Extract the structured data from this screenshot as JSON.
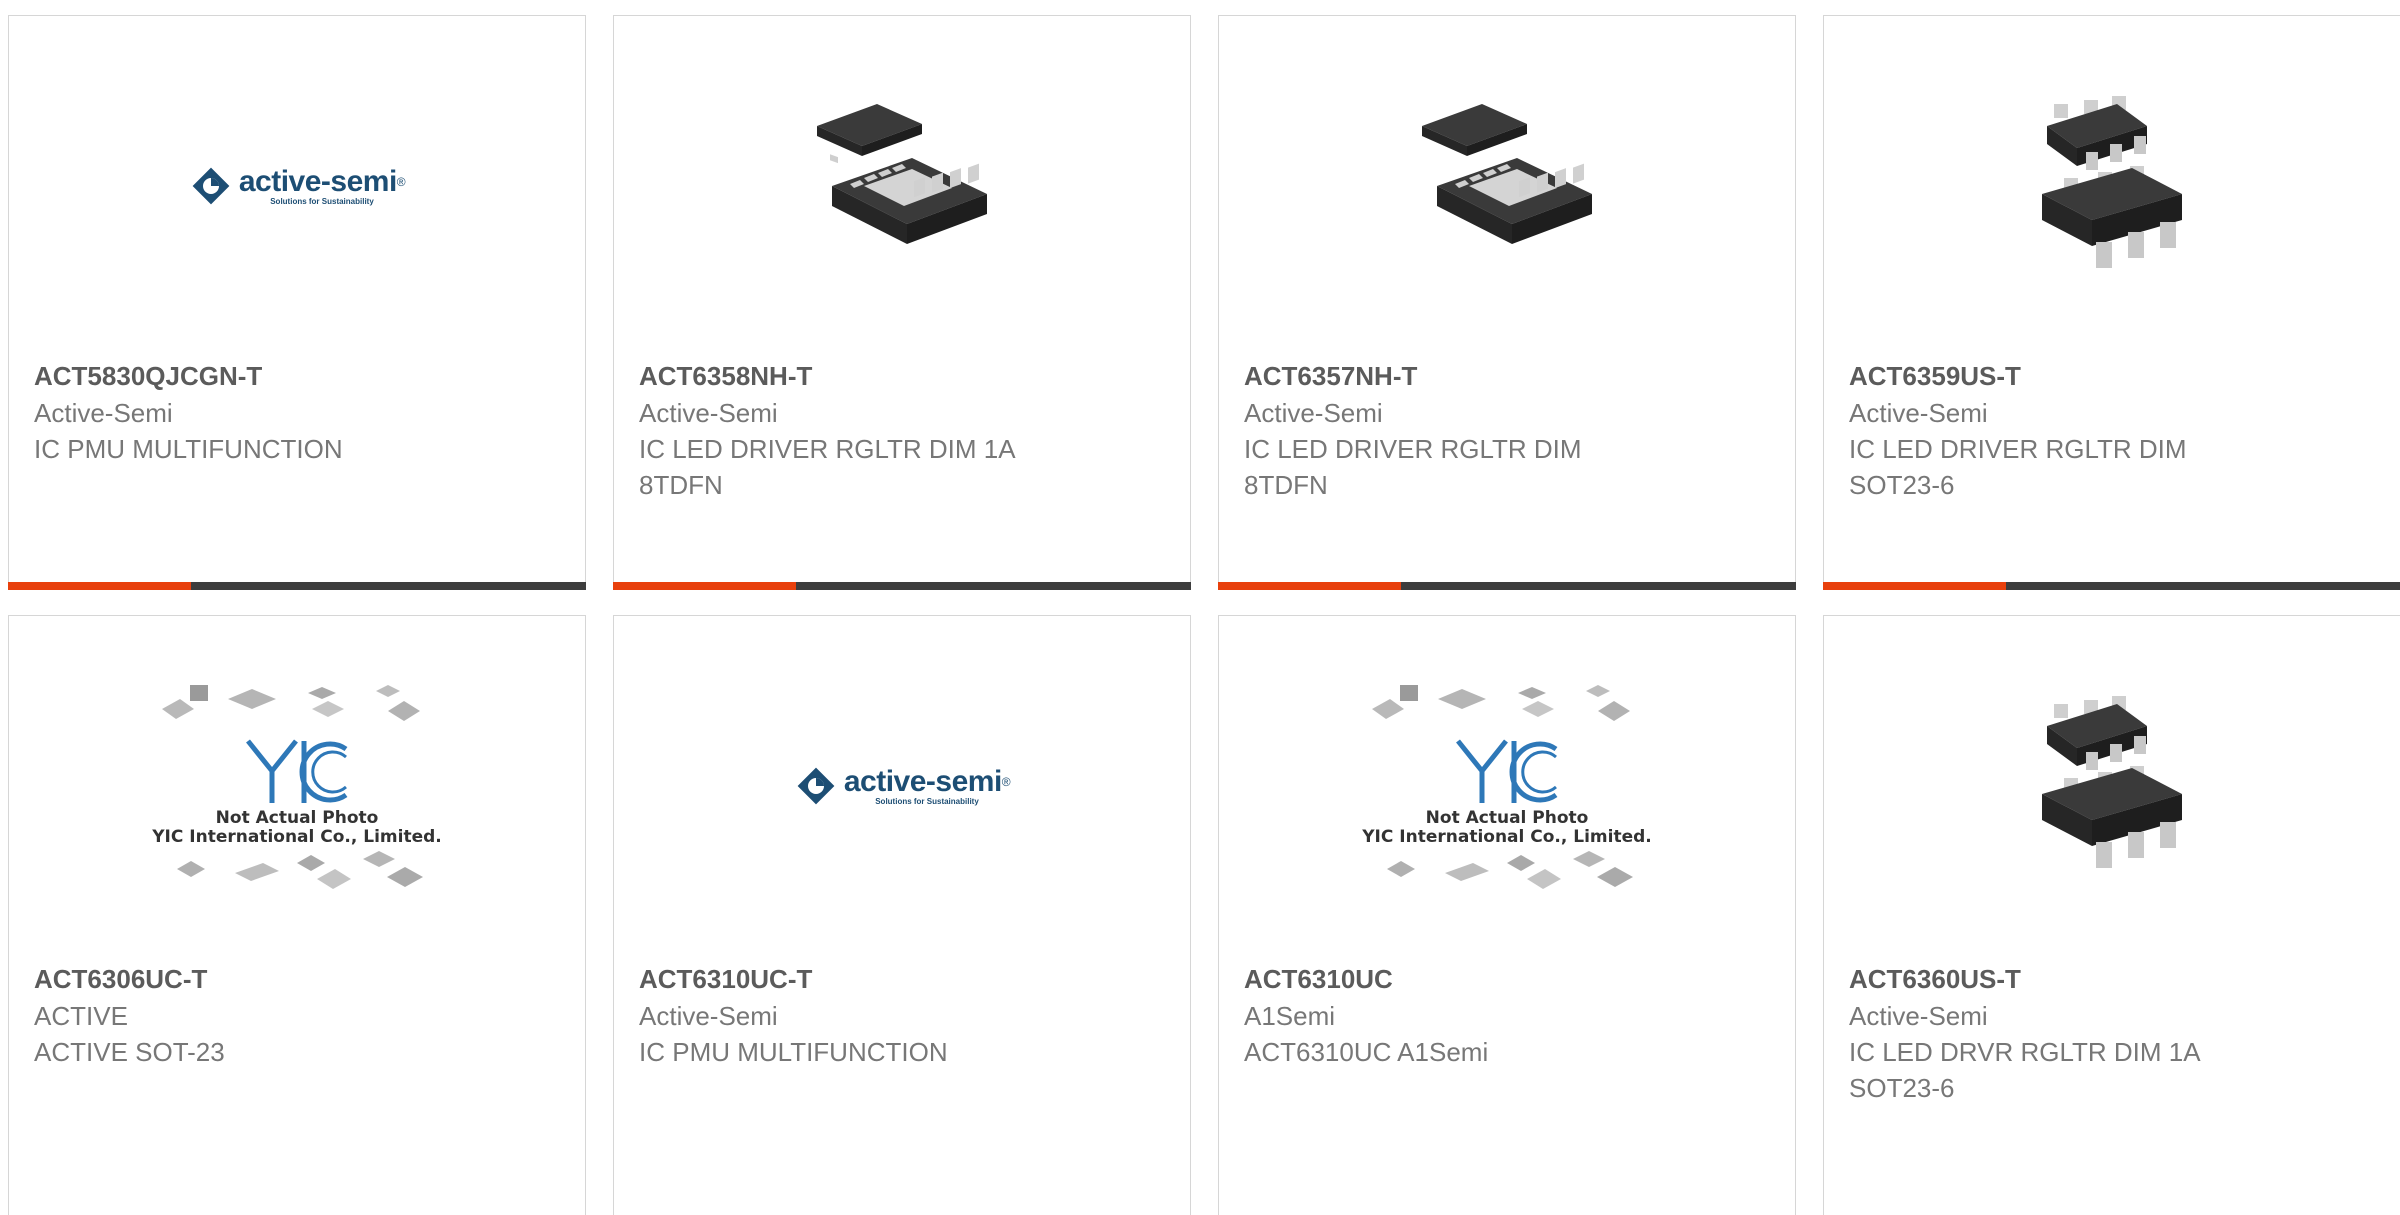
{
  "accent_color": "#e8400c",
  "bar_color": "#3d3d3d",
  "logo": {
    "name": "active-semi",
    "registered": "®",
    "tagline": "Solutions for Sustainability"
  },
  "placeholder": {
    "line1": "Not Actual Photo",
    "line2": "YIC International Co., Limited.",
    "logo_text": "YIC"
  },
  "products": [
    {
      "part_number": "ACT5830QJCGN-T",
      "manufacturer": "Active-Semi",
      "desc1": "IC PMU MULTIFUNCTION",
      "desc2": "",
      "image": "active-semi-logo"
    },
    {
      "part_number": "ACT6358NH-T",
      "manufacturer": "Active-Semi",
      "desc1": "IC LED DRIVER RGLTR DIM 1A",
      "desc2": "8TDFN",
      "image": "tdfn8-chip-icon"
    },
    {
      "part_number": "ACT6357NH-T",
      "manufacturer": "Active-Semi",
      "desc1": "IC LED DRIVER RGLTR DIM",
      "desc2": "8TDFN",
      "image": "tdfn8-chip-icon"
    },
    {
      "part_number": "ACT6359US-T",
      "manufacturer": "Active-Semi",
      "desc1": "IC LED DRIVER RGLTR DIM",
      "desc2": "SOT23-6",
      "image": "sot23-6-chip-icon"
    },
    {
      "part_number": "ACT6306UC-T",
      "manufacturer": "ACTIVE",
      "desc1": "ACTIVE SOT-23",
      "desc2": "",
      "image": "not-actual-photo"
    },
    {
      "part_number": "ACT6310UC-T",
      "manufacturer": "Active-Semi",
      "desc1": "IC PMU MULTIFUNCTION",
      "desc2": "",
      "image": "active-semi-logo"
    },
    {
      "part_number": "ACT6310UC",
      "manufacturer": "A1Semi",
      "desc1": "ACT6310UC A1Semi",
      "desc2": "",
      "image": "not-actual-photo"
    },
    {
      "part_number": "ACT6360US-T",
      "manufacturer": "Active-Semi",
      "desc1": "IC LED DRVR RGLTR DIM 1A",
      "desc2": "SOT23-6",
      "image": "sot23-6-chip-icon"
    }
  ]
}
